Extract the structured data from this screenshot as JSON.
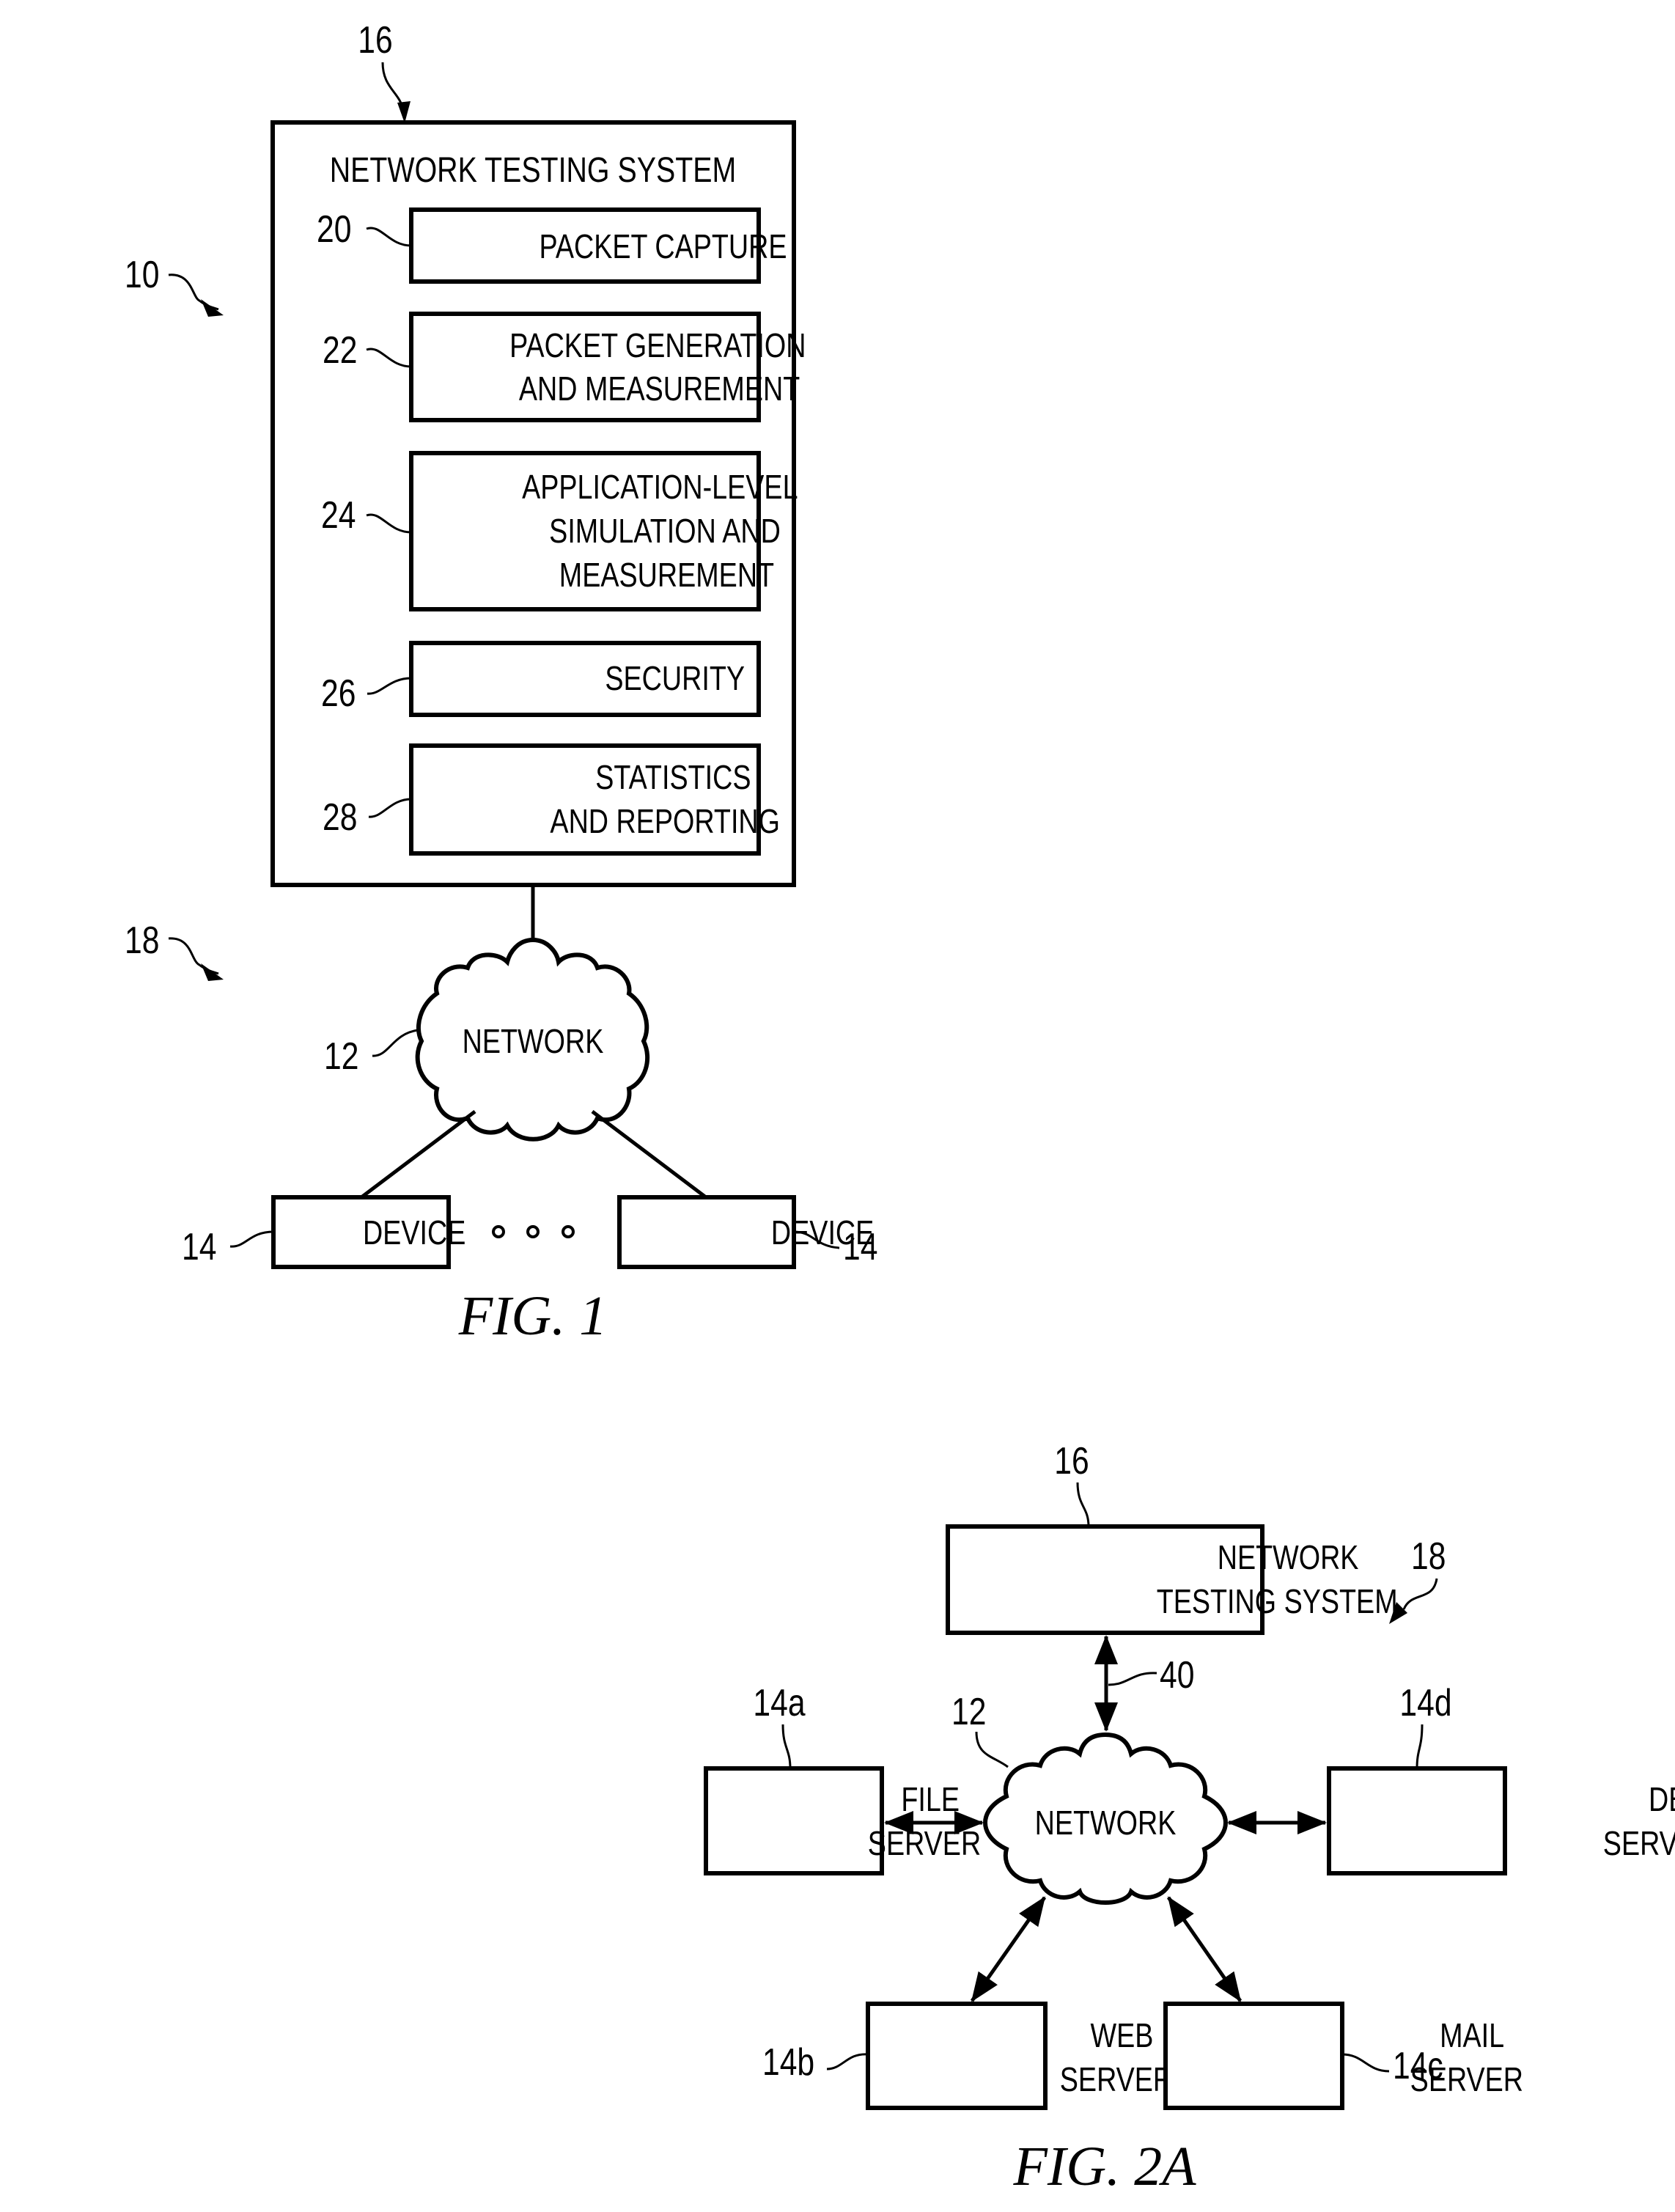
{
  "figures": {
    "fig1": {
      "caption": "FIG. 1",
      "ref_system": "10",
      "ref_environment": "18",
      "testing_system": {
        "ref": "16",
        "title": "NETWORK TESTING SYSTEM",
        "modules": [
          {
            "ref": "20",
            "lines": [
              "PACKET CAPTURE"
            ]
          },
          {
            "ref": "22",
            "lines": [
              "PACKET GENERATION",
              "AND MEASUREMENT"
            ]
          },
          {
            "ref": "24",
            "lines": [
              "APPLICATION-LEVEL",
              "SIMULATION AND",
              "MEASUREMENT"
            ]
          },
          {
            "ref": "26",
            "lines": [
              "SECURITY"
            ]
          },
          {
            "ref": "28",
            "lines": [
              "STATISTICS",
              "AND REPORTING"
            ]
          }
        ]
      },
      "network": {
        "ref": "12",
        "label": "NETWORK"
      },
      "devices": [
        {
          "ref": "14",
          "label": "DEVICE"
        },
        {
          "ref": "14",
          "label": "DEVICE"
        }
      ],
      "ellipsis": "o o o"
    },
    "fig2a": {
      "caption": "FIG. 2A",
      "ref_environment": "18",
      "testing_system": {
        "ref": "16",
        "lines": [
          "NETWORK",
          "TESTING SYSTEM"
        ]
      },
      "link": {
        "ref": "40"
      },
      "network": {
        "ref": "12",
        "label": "NETWORK"
      },
      "servers": [
        {
          "ref": "14a",
          "lines": [
            "FILE",
            "SERVER"
          ]
        },
        {
          "ref": "14b",
          "lines": [
            "WEB",
            "SERVER"
          ]
        },
        {
          "ref": "14c",
          "lines": [
            "MAIL",
            "SERVER"
          ]
        },
        {
          "ref": "14d",
          "lines": [
            "DB",
            "SERVER"
          ]
        }
      ]
    }
  }
}
